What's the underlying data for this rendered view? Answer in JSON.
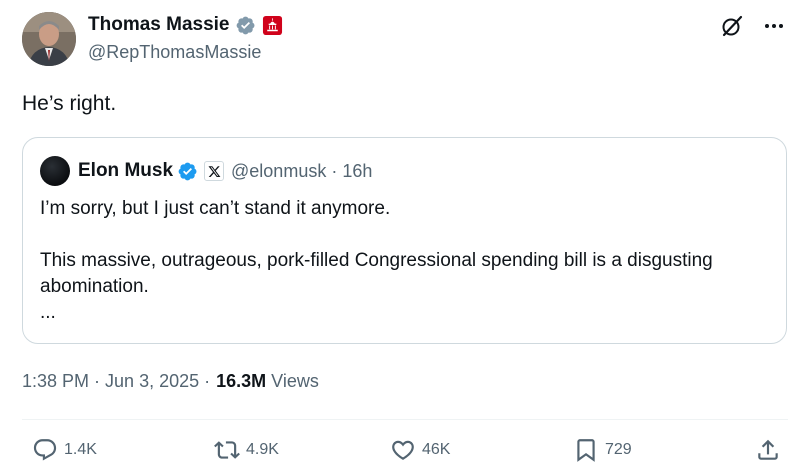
{
  "author": {
    "name": "Thomas Massie",
    "handle": "@RepThomasMassie",
    "verified_color": "#829aab",
    "affiliation_color": "#d0021b"
  },
  "tweet": {
    "text": "He’s right.",
    "time": "1:38 PM",
    "date": "Jun 3, 2025",
    "views_count": "16.3M",
    "views_label": "Views"
  },
  "quote": {
    "name": "Elon Musk",
    "handle": "@elonmusk",
    "time": "16h",
    "verified_color": "#1d9bf0",
    "lines": [
      "I’m sorry, but I just can’t stand it anymore.",
      "This massive, outrageous, pork-filled Congressional spending bill is a disgusting abomination.",
      "..."
    ]
  },
  "actions": {
    "replies": "1.4K",
    "reposts": "4.9K",
    "likes": "46K",
    "bookmarks": "729"
  },
  "colors": {
    "text": "#0f1419",
    "secondary": "#536471",
    "border": "#cfd9de"
  }
}
